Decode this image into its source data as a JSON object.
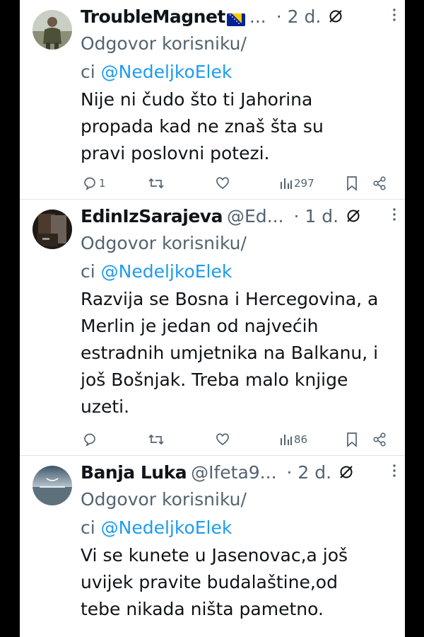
{
  "tweets": [
    {
      "name": "TroubleMagnet",
      "handle": "...",
      "time": "· 2 d.",
      "reply_prefix": "Odgovor korisniku/",
      "reply_line2_prefix": "ci ",
      "mention": "@NedeljkoElek",
      "text": "Nije ni čudo što ti Jahorina propada kad ne znaš šta su pravi poslovni potezi.",
      "replies": "1",
      "retweets": "",
      "likes": "",
      "views": "297"
    },
    {
      "name": "EdinIzSarajeva",
      "handle": "@Ed...",
      "time": "· 1 d.",
      "reply_prefix": "Odgovor korisniku/",
      "reply_line2_prefix": "ci ",
      "mention": "@NedeljkoElek",
      "text": "Razvija se Bosna i Hercegovina, a Merlin je jedan od najvećih estradnih umjetnika na Balkanu, i još Bošnjak. Treba malo knjige uzeti.",
      "replies": "",
      "retweets": "",
      "likes": "",
      "views": "86"
    },
    {
      "name": "Banja Luka",
      "handle": "@Ifeta9...",
      "time": "· 2 d.",
      "reply_prefix": "Odgovor korisniku/",
      "reply_line2_prefix": "ci ",
      "mention": "@NedeljkoElek",
      "text": "Vi se kunete u Jasenovac,a još uvijek pravite budalaštine,od tebe nikada ništa pametno."
    }
  ],
  "colors": {
    "link": "#1d9bf0",
    "muted": "#536471",
    "text": "#0f1419"
  },
  "icons": [
    "reply-icon",
    "retweet-icon",
    "like-icon",
    "views-icon",
    "bookmark-icon",
    "share-icon",
    "grok-icon",
    "more-icon",
    "bosnia-flag-icon"
  ]
}
